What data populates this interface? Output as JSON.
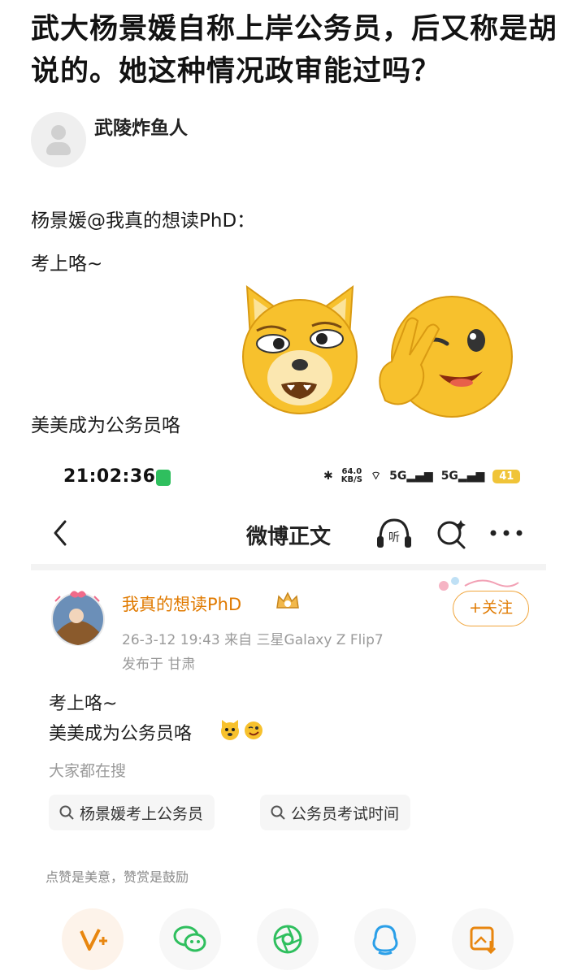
{
  "question": {
    "title": "武大杨景媛自称上岸公务员，后又称是胡说的。她这种情况政审能过吗？"
  },
  "answer": {
    "author": "武陵炸鱼人",
    "lines": [
      "杨景媛@我真的想读PhD：",
      "考上咯~",
      "美美成为公务员咯"
    ]
  },
  "screenshot": {
    "status_bar": {
      "time": "21:02:36",
      "net_speed_value": "64.0",
      "net_speed_unit": "KB/S",
      "signal1": "5G",
      "signal2": "5G",
      "battery": "41"
    },
    "nav": {
      "title": "微博正文"
    },
    "post": {
      "username": "我真的想读PhD",
      "meta": "26-3-12 19:43  来自 三星Galaxy Z Flip7",
      "location": "发布于 甘肃",
      "follow_label": "+关注",
      "body_line1": "考上咯~",
      "body_line2": "美美成为公务员咯"
    },
    "search": {
      "label": "大家都在搜",
      "chips": [
        "杨景媛考上公务员",
        "公务员考试时间"
      ]
    },
    "reward_text": "点赞是美意，赞赏是鼓励"
  },
  "colors": {
    "weibo_orange": "#e07a00",
    "emoji_yellow": "#f7c12d",
    "wechat_green": "#2fbf5e"
  }
}
